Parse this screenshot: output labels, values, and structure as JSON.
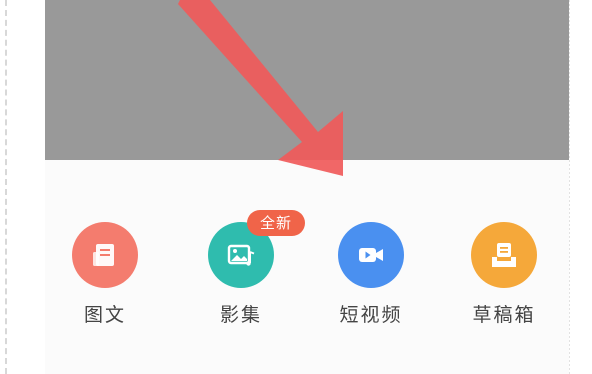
{
  "dim_color": "#999999",
  "annotation": {
    "arrow_color": "#f05a5a"
  },
  "post_options": [
    {
      "label": "图文",
      "icon": "article-icon",
      "color": "#f47c6e"
    },
    {
      "label": "影集",
      "icon": "photo-album-icon",
      "color": "#2fbcae",
      "badge": "全新",
      "badge_color": "#f06449"
    },
    {
      "label": "短视频",
      "icon": "video-camera-icon",
      "color": "#4a90f0"
    },
    {
      "label": "草稿箱",
      "icon": "drafts-icon",
      "color": "#f5a83a"
    }
  ]
}
